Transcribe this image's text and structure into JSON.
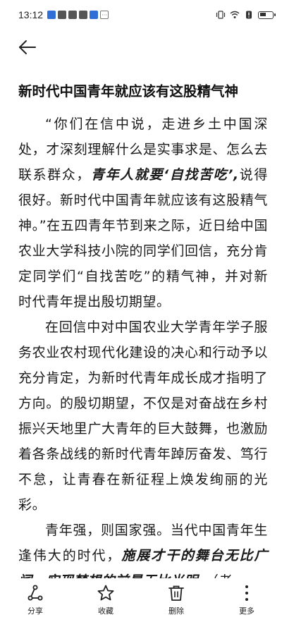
{
  "status_bar": {
    "time": "13:12"
  },
  "icons": {
    "back": "back-arrow-icon",
    "share": "share-icon",
    "favorite": "star-icon",
    "delete": "trash-icon",
    "more": "more-vertical-icon"
  },
  "article": {
    "title": "新时代中国青年就应该有这股精气神",
    "p1_a": "“你们在信中说，走进乡土中国深处，才深刻理解什么是实事求是、怎么去联系群众，",
    "p1_emph": "青年人就要‘自找苦吃’,",
    "p1_b": "说得很好。新时代中国青年就应该有这股精气神。”在五四青年节到来之际，近日给中国农业大学科技小院的同学们回信，充分肯定同学们“自找苦吃”的精气神，并对新时代青年提出殷切期望。",
    "p2": "在回信中对中国农业大学青年学子服务农业农村现代化建设的决心和行动予以充分肯定，为新时代青年成长成才指明了方向。的殷切期望，不仅是对奋战在乡村振兴天地里广大青年的巨大鼓舞，也激励着各条战线的新时代青年踔厉奋发、笃行不怠，让青春在新征程上焕发绚丽的光彩。",
    "p3_a": "青年强，则国家强。当代中国青年生逢伟大的时代，",
    "p3_emph": "施展才干的舞台无比广阔，实现梦想的前景无比光明。",
    "p3_b": "（老"
  },
  "toolbar": {
    "share_label": "分享",
    "favorite_label": "收藏",
    "delete_label": "删除",
    "more_label": "更多"
  }
}
